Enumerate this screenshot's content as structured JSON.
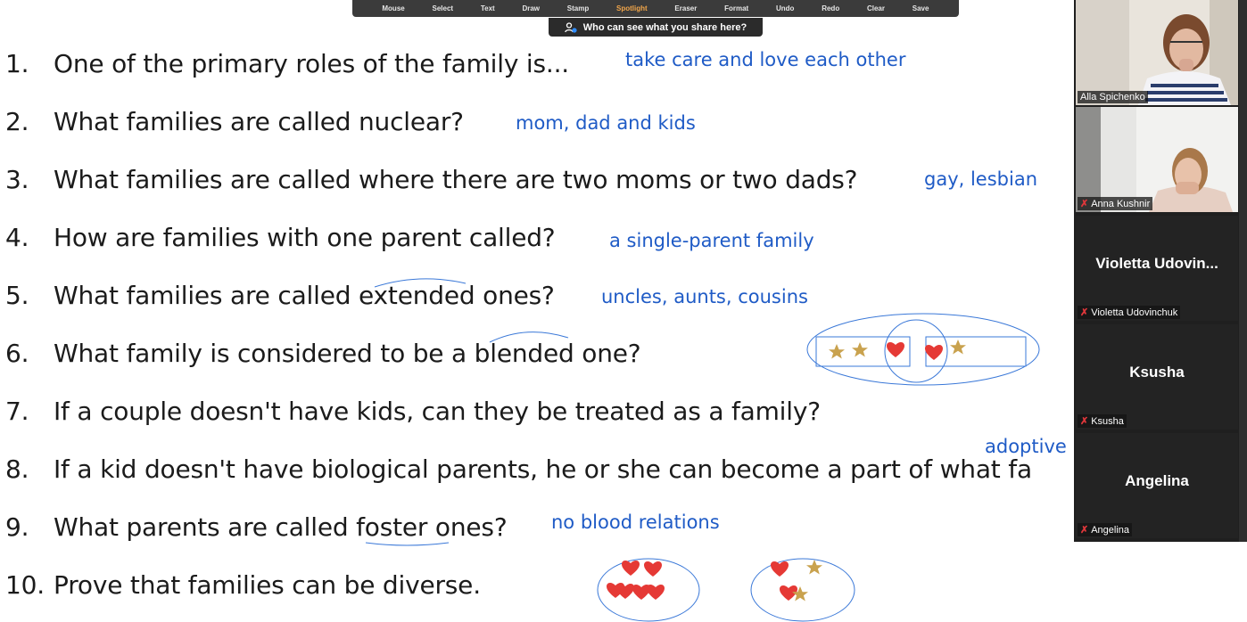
{
  "toolbar": {
    "tools": [
      {
        "label": "Mouse"
      },
      {
        "label": "Select"
      },
      {
        "label": "Text"
      },
      {
        "label": "Draw"
      },
      {
        "label": "Stamp"
      },
      {
        "label": "Spotlight",
        "active": true
      },
      {
        "label": "Eraser"
      },
      {
        "label": "Format"
      },
      {
        "label": "Undo"
      },
      {
        "label": "Redo"
      },
      {
        "label": "Clear"
      },
      {
        "label": "Save"
      }
    ],
    "share_notice": "Who can see what you share here?"
  },
  "slide": {
    "questions": [
      {
        "num": "1.",
        "text": "One of the primary roles of the family is..."
      },
      {
        "num": "2.",
        "text": "What families are called nuclear?"
      },
      {
        "num": "3.",
        "text": "What families are called where there are two moms or two dads?"
      },
      {
        "num": "4.",
        "text": "How are families with one parent called?"
      },
      {
        "num": "5.",
        "text": "What families are called extended ones?"
      },
      {
        "num": "6.",
        "text": "What family is considered to be a blended one?"
      },
      {
        "num": "7.",
        "text": "If a couple doesn't have kids, can they be treated as a family?"
      },
      {
        "num": "8.",
        "text": "If a kid doesn't have biological parents, he or she can become a part of what fa"
      },
      {
        "num": "9.",
        "text": "What parents are called foster ones?"
      },
      {
        "num": "10.",
        "text": "Prove that families can be diverse."
      }
    ],
    "answers": {
      "q1": "take care and love each other",
      "q2": "mom, dad and kids",
      "q3": "gay, lesbian",
      "q4": "a single-parent family",
      "q5": "uncles, aunts, cousins",
      "q8": "adoptive",
      "q9": "no blood relations"
    },
    "colors": {
      "ink": "#1f5bc6",
      "heart": "#e53935",
      "star": "#c9a24e"
    }
  },
  "participants": [
    {
      "name": "Alla Spichenko",
      "video": true,
      "muted": false
    },
    {
      "name": "Anna Kushnir",
      "video": true,
      "muted": true,
      "active": true
    },
    {
      "display": "Violetta  Udovin...",
      "name": "Violetta Udovinchuk",
      "video": false,
      "muted": true
    },
    {
      "display": "Ksusha",
      "name": "Ksusha",
      "video": false,
      "muted": true
    },
    {
      "display": "Angelina",
      "name": "Angelina",
      "video": false,
      "muted": true
    }
  ]
}
